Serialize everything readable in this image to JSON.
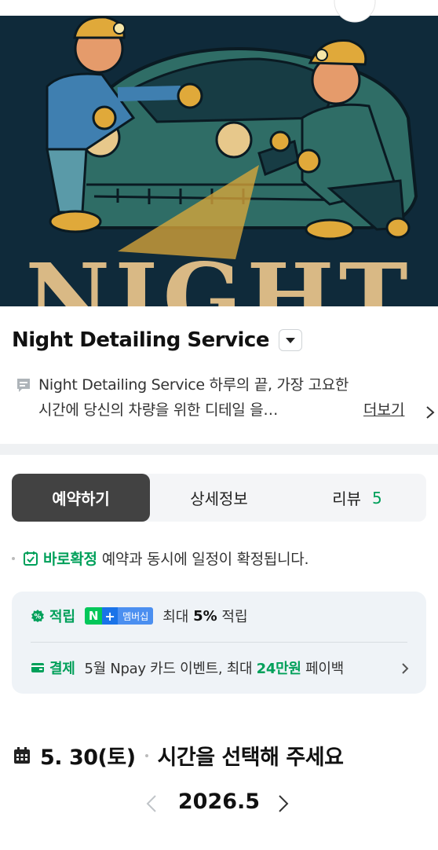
{
  "hero": {
    "image": "night-detailing-illustration",
    "overlay_text": "NIGHT"
  },
  "store": {
    "name": "Night Detailing Service",
    "description": "Night Detailing Service 하루의 끝, 가장 고요한 시간에 당신의 차량을 위한 디테일 을…",
    "more_label": "더보기"
  },
  "tabs": [
    {
      "label": "예약하기",
      "active": true
    },
    {
      "label": "상세정보",
      "active": false
    },
    {
      "label": "리뷰",
      "count": "5",
      "active": false
    }
  ],
  "confirm": {
    "highlight": "바로확정",
    "text": "예약과 동시에 일정이 확정됩니다."
  },
  "benefits": {
    "points": {
      "label": "적립",
      "badge_n": "N",
      "badge_plus": "+",
      "badge_membership": "멤버십",
      "text_prefix": "최대",
      "text_value": "5%",
      "text_suffix": "적립"
    },
    "payment": {
      "label": "결제",
      "text_prefix": "5월 Npay 카드 이벤트, 최대",
      "text_value": "24만원",
      "text_suffix": "페이백"
    }
  },
  "booking": {
    "date": "5. 30(토)",
    "prompt": "시간을 선택해 주세요",
    "month": "2026.5"
  },
  "colors": {
    "accent_green": "#00a05a",
    "active_tab": "#424242",
    "hero_bg": "#0f2a3a",
    "car": "#2f6d66",
    "gold": "#d9b985"
  }
}
